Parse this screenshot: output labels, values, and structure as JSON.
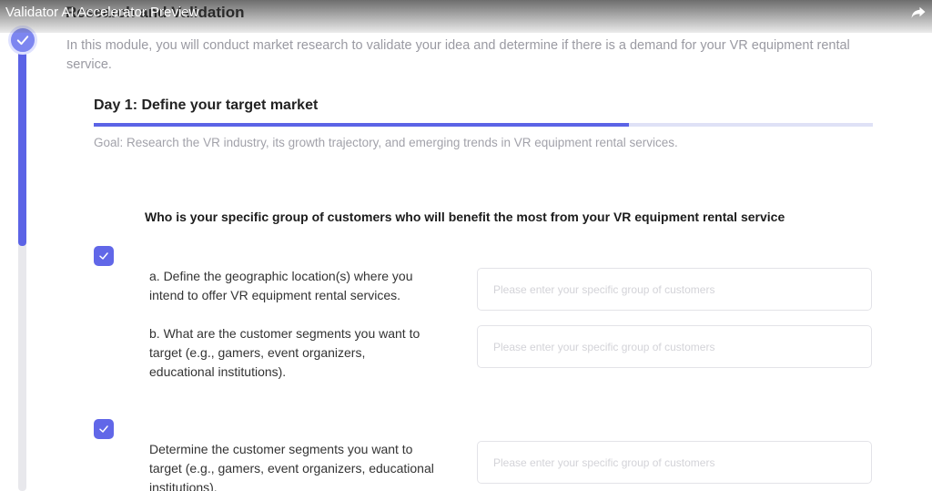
{
  "video": {
    "title": "Validator AI Accelerator Preview",
    "share_icon": "share-arrow-icon"
  },
  "module": {
    "title": "Research and Validation",
    "intro": "In this module, you will conduct market research to validate your idea and determine if there is a demand for your VR equipment rental service."
  },
  "day": {
    "title": "Day 1: Define your target market",
    "progress_fraction": 0.687,
    "goal": "Goal: Research the VR industry, its growth trajectory, and emerging trends in VR equipment rental services."
  },
  "question": {
    "text": "Who is your specific group of customers who will benefit the most from your VR equipment rental service"
  },
  "items": [
    {
      "label": "a. Define the geographic location(s) where you intend to offer VR equipment rental services.",
      "placeholder": "Please enter your specific group of customers"
    },
    {
      "label": "b. What are the customer segments you want to target (e.g., gamers, event organizers, educational institutions).",
      "placeholder": "Please enter your specific group of customers"
    },
    {
      "label": "Determine the customer segments you want to target (e.g., gamers, event organizers, educational institutions).",
      "placeholder": "Please enter your specific group of customers"
    }
  ],
  "colors": {
    "accent": "#5b63e6",
    "check": "#6167e8",
    "rail": "#e8e8ec"
  }
}
